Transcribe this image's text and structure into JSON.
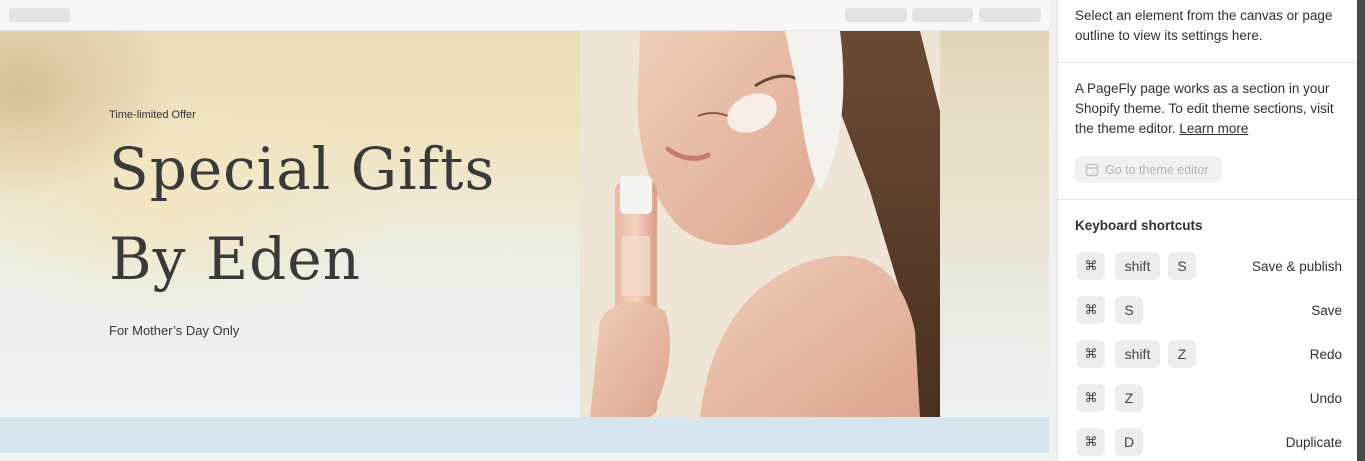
{
  "hero": {
    "eyebrow": "Time-limited Offer",
    "headline_line1": "Special Gifts",
    "headline_line2": "By Eden",
    "subline": "For Mother’s Day Only"
  },
  "panel": {
    "intro": "Select an element from the canvas or page outline to view its settings here.",
    "info_text": "A PageFly page works as a section in your Shopify theme. To edit theme sections, visit the theme editor.",
    "learn_more": "Learn more",
    "theme_button": "Go to theme editor",
    "keyboard_title": "Keyboard shortcuts",
    "shortcuts": [
      {
        "keys": [
          "⌘",
          "shift",
          "S"
        ],
        "label": "Save & publish"
      },
      {
        "keys": [
          "⌘",
          "S"
        ],
        "label": "Save"
      },
      {
        "keys": [
          "⌘",
          "shift",
          "Z"
        ],
        "label": "Redo"
      },
      {
        "keys": [
          "⌘",
          "Z"
        ],
        "label": "Undo"
      },
      {
        "keys": [
          "⌘",
          "D"
        ],
        "label": "Duplicate"
      }
    ]
  },
  "colors": {
    "strip": "#d7e5ee",
    "headline": "#3a3a3a",
    "key_bg": "#ededed"
  }
}
